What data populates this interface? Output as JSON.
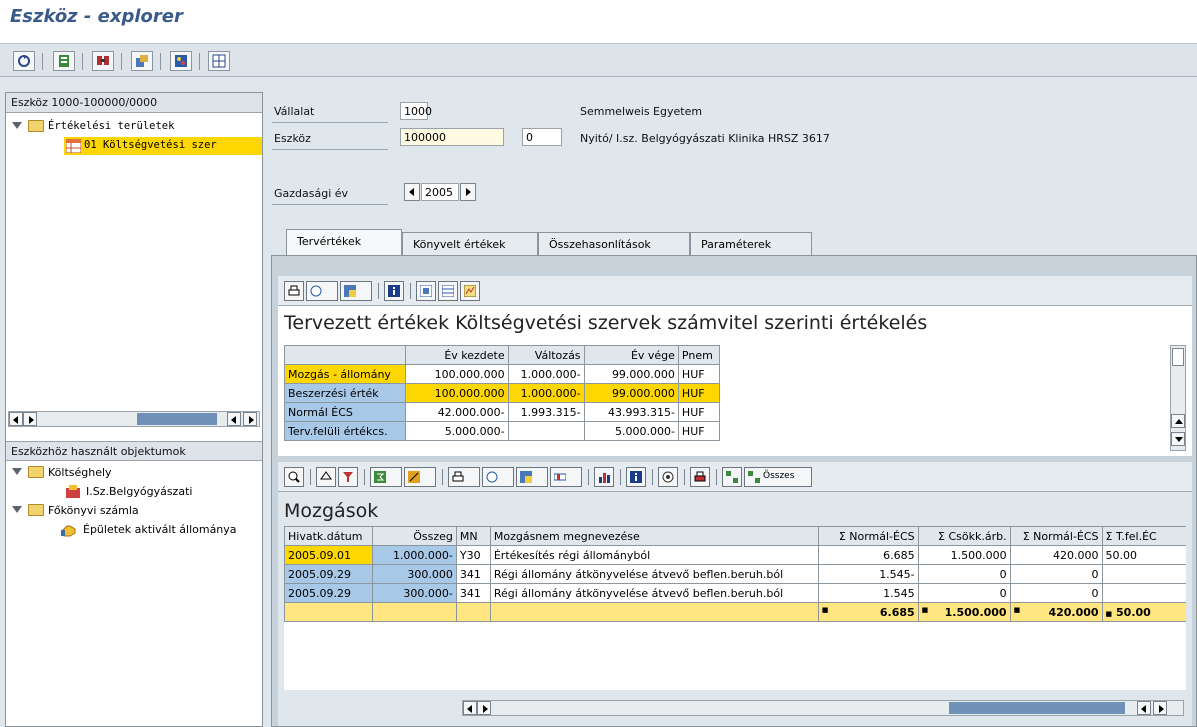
{
  "window": {
    "title": "Eszköz - explorer"
  },
  "toolbar": {
    "icons": [
      "refresh-icon",
      "overview-icon",
      "search-icon",
      "layout-icon",
      "display-icon",
      "grid-icon"
    ]
  },
  "left": {
    "top_header": "Eszköz 1000-100000/0000",
    "tree1": {
      "root": "Értékelési területek",
      "child": "01 Költségvetési szer"
    },
    "bottom_header": "Eszközhöz használt objektumok",
    "tree2": {
      "node1": "Költséghely",
      "node1_child": "I.Sz.Belgyógyászati",
      "node2": "Főkönyvi számla",
      "node2_child": "Épületek aktivált állománya"
    }
  },
  "header": {
    "company_label": "Vállalat",
    "company_value": "1000",
    "company_desc": "Semmelweis Egyetem",
    "asset_label": "Eszköz",
    "asset_value": "100000",
    "asset_sub": "0",
    "asset_desc": "Nyitó/ I.sz. Belgyógyászati Klinika HRSZ 3617",
    "year_label": "Gazdasági év",
    "year_value": "2005"
  },
  "tabs": [
    "Tervértékek",
    "Könyvelt értékek",
    "Összehasonlítások",
    "Paraméterek"
  ],
  "planned": {
    "title": "Tervezett értékek Költségvetési szervek számvitel szerinti értékelés",
    "columns": [
      "",
      "Év kezdete",
      "Változás",
      "Év vége",
      "Pnem"
    ],
    "rows": [
      [
        "Mozgás - állomány",
        "100.000.000",
        "1.000.000-",
        "99.000.000",
        "HUF"
      ],
      [
        "Beszerzési érték",
        "100.000.000",
        "1.000.000-",
        "99.000.000",
        "HUF"
      ],
      [
        "Normál ÉCS",
        "42.000.000-",
        "1.993.315-",
        "43.993.315-",
        "HUF"
      ],
      [
        "Terv.felüli értékcs.",
        "5.000.000-",
        "",
        "5.000.000-",
        "HUF"
      ]
    ]
  },
  "movements": {
    "toolbar_sum_label": "Összes",
    "title": "Mozgások",
    "columns": [
      "Hivatk.dátum",
      "Összeg",
      "MN",
      "Mozgásnem megnevezése",
      "Σ Normál-ÉCS",
      "Σ Csökk.árb.",
      "Σ Normál-ÉCS",
      "Σ T.fel.ÉC"
    ],
    "rows": [
      [
        "2005.09.01",
        "1.000.000-",
        "Y30",
        "Értékesítés régi állományból",
        "6.685",
        "1.500.000",
        "420.000",
        "50.00"
      ],
      [
        "2005.09.29",
        "300.000",
        "341",
        "Régi állomány átkönyvelése átvevő beflen.beruh.ból",
        "1.545-",
        "0",
        "0",
        ""
      ],
      [
        "2005.09.29",
        "300.000-",
        "341",
        "Régi állomány átkönyvelése átvevő beflen.beruh.ból",
        "1.545",
        "0",
        "0",
        ""
      ]
    ],
    "totals": [
      "6.685",
      "1.500.000",
      "420.000",
      "50.00"
    ],
    "total_marker": "■"
  },
  "colors": {
    "title_blue": "#3a5a8a",
    "selection_yellow": "#ffd700",
    "header_blue": "#a8c8e8",
    "total_yellow": "#ffe680"
  }
}
